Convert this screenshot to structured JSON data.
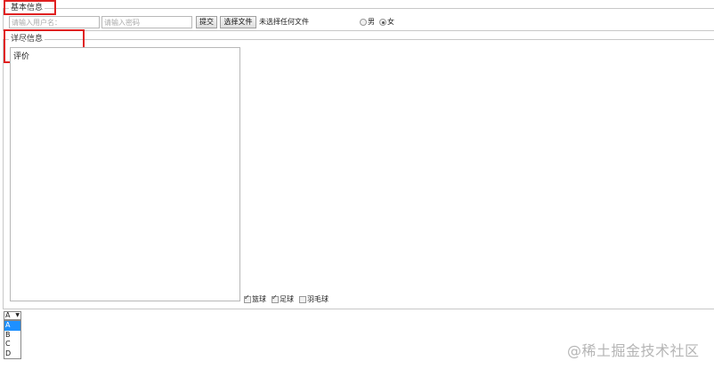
{
  "basic_info": {
    "legend": "基本信息",
    "username_placeholder": "请输入用户名：",
    "password_placeholder": "请输入密码",
    "submit_label": "提交",
    "file_button_label": "选择文件",
    "file_status": "未选择任何文件",
    "gender": {
      "options": [
        {
          "label": "男",
          "checked": false
        },
        {
          "label": "女",
          "checked": true
        }
      ]
    }
  },
  "detail_info": {
    "legend": "详尽信息",
    "comment_value": "评价",
    "hobbies": [
      {
        "label": "篮球",
        "checked": true
      },
      {
        "label": "足球",
        "checked": true
      },
      {
        "label": "羽毛球",
        "checked": false
      }
    ]
  },
  "select": {
    "selected": "A",
    "options": [
      "A",
      "B",
      "C",
      "D"
    ]
  },
  "watermark": "@稀土掘金技术社区",
  "colors": {
    "highlight": "#e02020",
    "selected_option": "#1e90ff"
  }
}
